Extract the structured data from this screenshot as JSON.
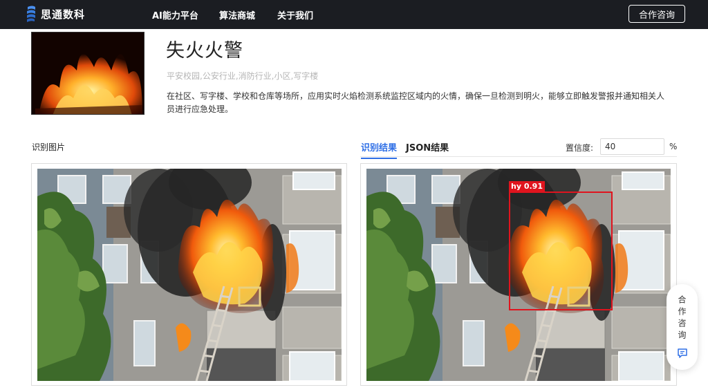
{
  "brand": {
    "name": "思通数科",
    "accent": "#2f6fe6",
    "logo_icon": "stacked-waves-logo-icon"
  },
  "nav": {
    "items": [
      {
        "label": "AI能力平台"
      },
      {
        "label": "算法商城"
      },
      {
        "label": "关于我们"
      }
    ],
    "cta_label": "合作咨询"
  },
  "scene": {
    "title": "失火火警",
    "tags": "平安校园,公安行业,消防行业,小区,写字楼",
    "description": "在社区、写字楼、学校和仓库等场所，应用实时火焰检测系统监控区域内的火情，确保一旦检测到明火，能够立即触发警报并通知相关人员进行应急处理。"
  },
  "input_panel": {
    "label": "识别图片"
  },
  "result_panel": {
    "tabs": [
      {
        "label": "识别结果",
        "active": true
      },
      {
        "label": "JSON结果",
        "active": false
      }
    ],
    "confidence_label": "置信度:",
    "confidence_value": "40",
    "confidence_unit": "%",
    "detections": [
      {
        "label": "hy 0.91",
        "class": "hy",
        "score": 0.91,
        "color": "#e0141e"
      }
    ]
  },
  "float_consult": {
    "label": "合作咨询",
    "icon": "chat-message-icon"
  }
}
